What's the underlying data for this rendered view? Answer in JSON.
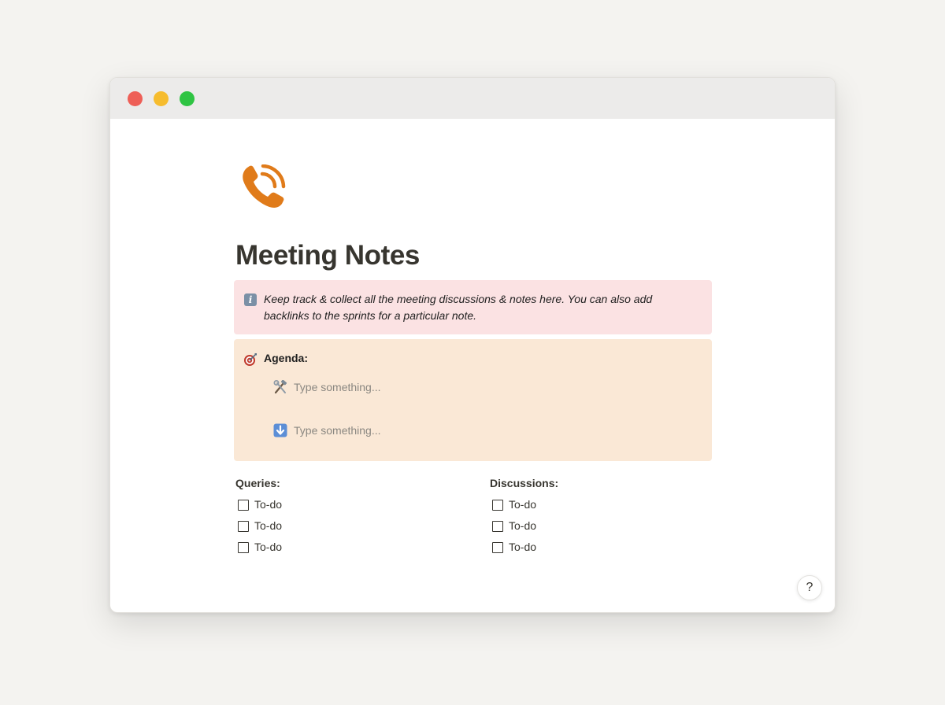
{
  "window": {
    "controls": [
      "close",
      "minimize",
      "maximize"
    ]
  },
  "page": {
    "icon": "telephone-receiver-icon",
    "title": "Meeting Notes"
  },
  "info_callout": {
    "icon": "information-icon",
    "icon_glyph": "i",
    "text": "Keep track & collect all the meeting discussions & notes here. You can also add backlinks to the sprints for a particular note."
  },
  "agenda": {
    "icon": "direct-hit-icon",
    "label": "Agenda:",
    "items": [
      {
        "icon": "hammer-and-wrench-icon",
        "placeholder": "Type something..."
      },
      {
        "icon": "down-arrow-icon",
        "placeholder": "Type something..."
      }
    ]
  },
  "queries": {
    "heading": "Queries:",
    "todos": [
      "To-do",
      "To-do",
      "To-do"
    ]
  },
  "discussions": {
    "heading": "Discussions:",
    "todos": [
      "To-do",
      "To-do",
      "To-do"
    ]
  },
  "help": {
    "label": "?"
  },
  "colors": {
    "info_callout_bg": "#fbe2e3",
    "agenda_callout_bg": "#fae8d6",
    "icon_orange": "#e07b1a"
  }
}
